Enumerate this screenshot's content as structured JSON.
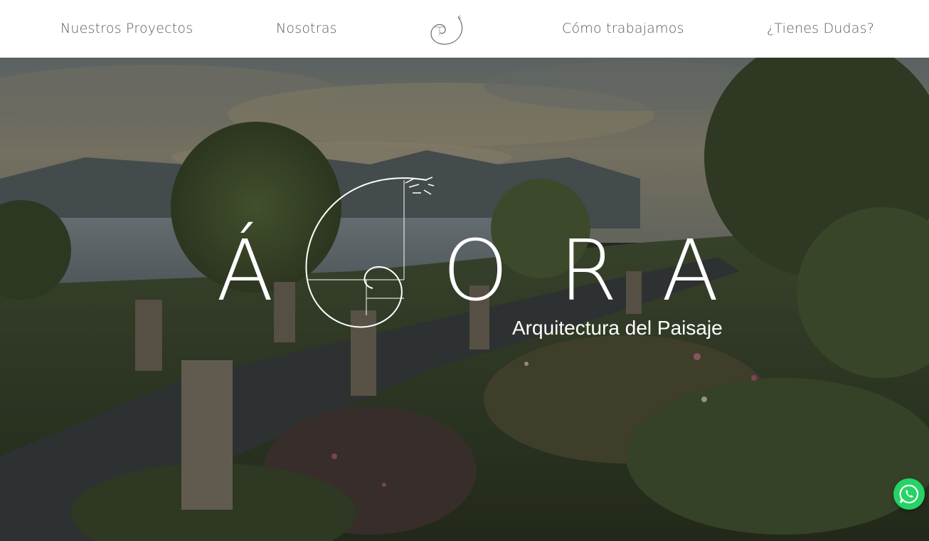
{
  "nav": {
    "items": [
      "Nuestros Proyectos",
      "Nosotras",
      "Cómo trabajamos",
      "¿Tienes Dudas?"
    ]
  },
  "hero": {
    "letters": [
      "Á",
      "O",
      "R",
      "A"
    ],
    "tagline": "Arquitectura del Paisaje"
  },
  "colors": {
    "nav_text": "#5a5a5a",
    "hero_text": "#ffffff",
    "whatsapp": "#25D366"
  },
  "icons": {
    "logo": "golden-spiral-logo",
    "whatsapp": "whatsapp-icon"
  }
}
